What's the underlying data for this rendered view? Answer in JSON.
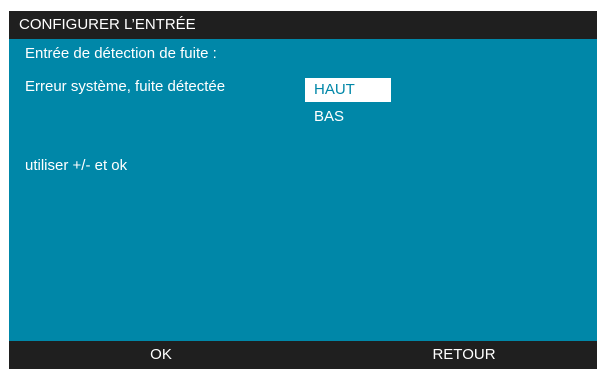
{
  "colors": {
    "background": "#0087a8",
    "bars": "#1f1f1f",
    "text": "#ffffff",
    "selected_bg": "#ffffff"
  },
  "header": {
    "title": "CONFIGURER L’ENTRÉE"
  },
  "main": {
    "input_label": "Entrée de détection de fuite :",
    "error_label": "Erreur système, fuite détectée",
    "options": [
      {
        "label": "HAUT",
        "selected": true
      },
      {
        "label": "BAS",
        "selected": false
      }
    ],
    "hint": "utiliser +/- et ok"
  },
  "footer": {
    "ok_label": "OK",
    "back_label": "RETOUR"
  }
}
